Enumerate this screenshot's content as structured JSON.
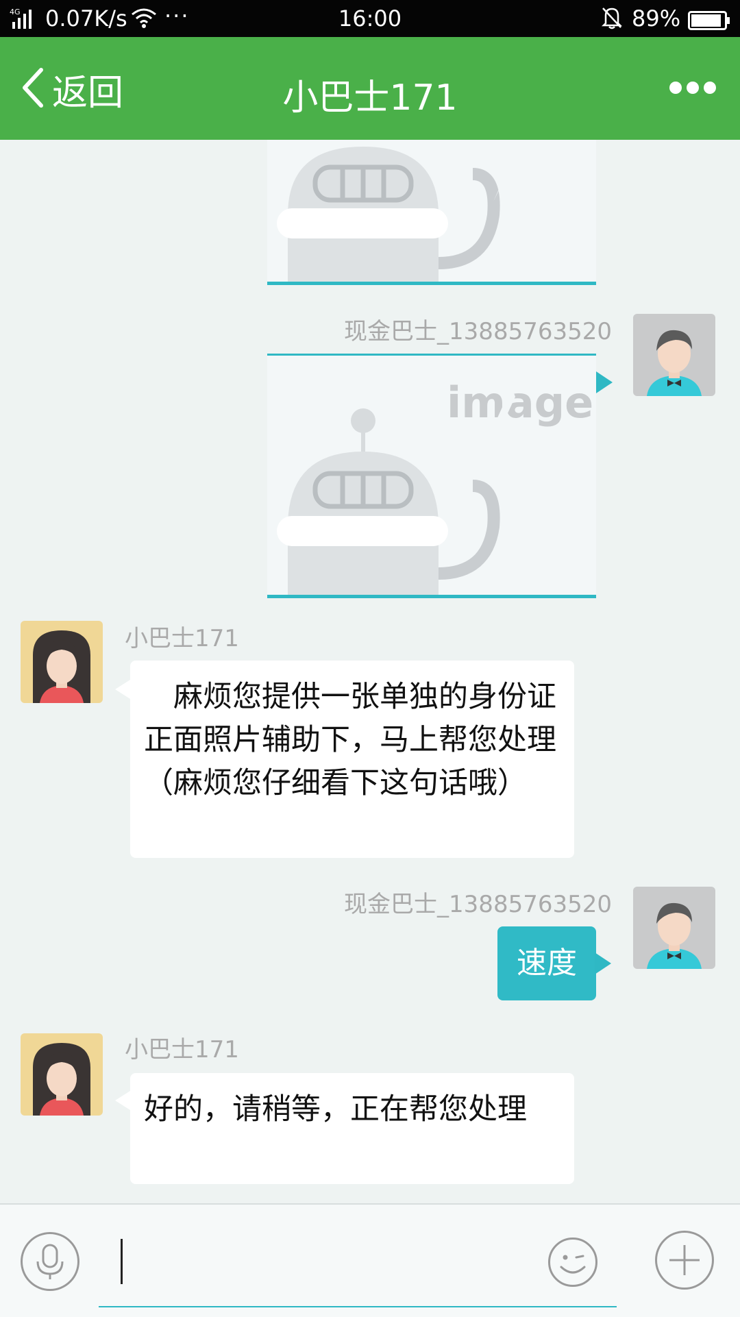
{
  "status_bar": {
    "network_type": "4G",
    "speed": "0.07K/s",
    "overflow": "···",
    "time": "16:00",
    "battery": "89%",
    "icons": [
      "signal-icon",
      "wifi-icon",
      "notifications-muted-icon",
      "battery-icon"
    ]
  },
  "header": {
    "back_label": "返回",
    "title": "小巴士171",
    "more_icon": "more-dots-icon",
    "background": "#4ab049"
  },
  "messages": [
    {
      "type": "image",
      "from": "me",
      "content": "broken-image-placeholder"
    },
    {
      "type": "image",
      "from": "me",
      "sender": "现金巴士_13885763520",
      "content": "broken-image-placeholder",
      "placeholder_text": "image"
    },
    {
      "type": "text",
      "from": "agent",
      "sender": "小巴士171",
      "text": "　麻烦您提供一张单独的身份证正面照片辅助下，马上帮您处理（麻烦您仔细看下这句话哦）"
    },
    {
      "type": "text",
      "from": "me",
      "sender": "现金巴士_13885763520",
      "text": "速度"
    },
    {
      "type": "text",
      "from": "agent",
      "sender": "小巴士171",
      "text": "好的，请稍等，正在帮您处理"
    }
  ],
  "input_bar": {
    "value": "",
    "placeholder": "",
    "icons": [
      "microphone-icon",
      "emoji-icon",
      "plus-icon"
    ]
  },
  "colors": {
    "accent": "#4ab049",
    "my_bubble": "#30bac6",
    "chat_background": "#eef3f2"
  }
}
